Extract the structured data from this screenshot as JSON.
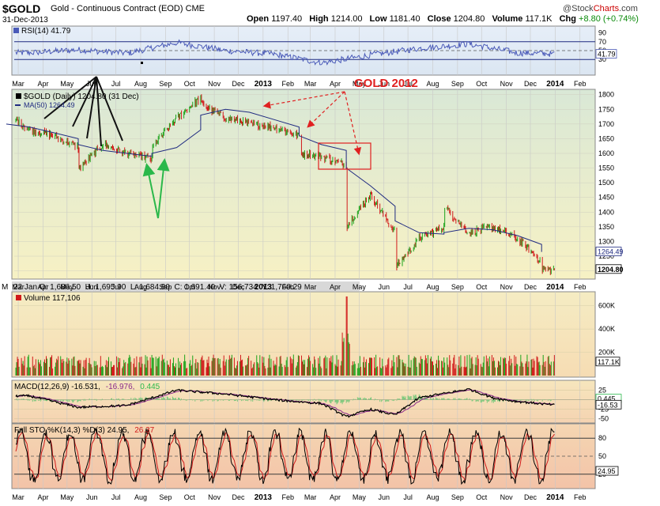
{
  "header": {
    "symbol": "$GOLD",
    "description": "Gold - Continuous Contract (EOD)",
    "exchange": "CME",
    "date": "31-Dec-2013",
    "open_label": "Open",
    "open": "1197.40",
    "high_label": "High",
    "high": "1214.00",
    "low_label": "Low",
    "low": "1181.40",
    "close_label": "Close",
    "close": "1204.80",
    "volume_label": "Volume",
    "volume": "117.1K",
    "chg_label": "Chg",
    "chg": "+8.80 (+0.74%)",
    "brand_at": "@",
    "brand_stock": "Stock",
    "brand_charts": "Charts",
    "brand_com": ".com"
  },
  "colors": {
    "price_bg_top": "#d9e8d6",
    "price_bg_bottom": "#f7f1c4",
    "lower_bg_top": "#f7f1c4",
    "lower_bg_bottom": "#f5c8ad",
    "panel_bg": "#f2f2f2",
    "up": "#1aa31a",
    "down": "#d11a1a",
    "ma": "#1f2a80",
    "rsi": "#4a5ab8",
    "annotation_red": "#e02020",
    "annotation_green": "#2ab84a",
    "annotation_black": "#111111"
  },
  "x_axis_labels": [
    "Mar",
    "Apr",
    "May",
    "Jun",
    "Jul",
    "Aug",
    "Sep",
    "Oct",
    "Nov",
    "Dec",
    "2013",
    "Feb",
    "Mar",
    "Apr",
    "May",
    "Jun",
    "Jul",
    "Aug",
    "Sep",
    "Oct",
    "Nov",
    "Dec",
    "2014",
    "Feb"
  ],
  "x_axis_bold": [
    "2013",
    "2014"
  ],
  "info_bar": {
    "prefix": "M",
    "text": "22 Jan O: 1,686.50  H: 1,695.90  L: 1,684.80  C: 1,691.40  V: 156,734  Y: 1,760.29"
  },
  "annotations": {
    "title": "GOLD 2012"
  },
  "chart_data": [
    {
      "type": "line",
      "panel": "rsi",
      "title": "RSI(14) 41.79",
      "ylim": [
        0,
        100
      ],
      "ticks": [
        30,
        50,
        70,
        90
      ],
      "levels": [
        30,
        70
      ],
      "last_label": "41.79",
      "x": [
        "2012-03",
        "2012-05",
        "2012-07",
        "2012-09",
        "2012-11",
        "2013-01",
        "2013-03",
        "2013-05",
        "2013-07",
        "2013-09",
        "2013-11",
        "2014-01"
      ],
      "values": [
        45,
        52,
        44,
        68,
        50,
        42,
        22,
        40,
        55,
        65,
        45,
        41.79
      ]
    },
    {
      "type": "bar",
      "panel": "price",
      "title": "$GOLD (Daily) 1204.80 (31 Dec)",
      "ma_label": "MA(50) 1264.49",
      "ylim": [
        1180,
        1810
      ],
      "ticks": [
        1200,
        1250,
        1300,
        1350,
        1400,
        1450,
        1500,
        1550,
        1600,
        1650,
        1700,
        1750,
        1800
      ],
      "tick_labels": [
        "1200",
        "1250",
        "1300",
        "1350",
        "1400",
        "1450",
        "1500",
        "1550",
        "1600",
        "1650",
        "1700",
        "1750",
        "1800"
      ],
      "last_label": "1204.80",
      "ma_last_label": "1264.49",
      "x": [
        "2012-02",
        "2012-03",
        "2012-04",
        "2012-05",
        "2012-05",
        "2012-06",
        "2012-07",
        "2012-08",
        "2012-08",
        "2012-09",
        "2012-10",
        "2012-10",
        "2012-11",
        "2012-12",
        "2013-01",
        "2013-02",
        "2013-02",
        "2013-03",
        "2013-04",
        "2013-04",
        "2013-05",
        "2013-06",
        "2013-06",
        "2013-07",
        "2013-08",
        "2013-08",
        "2013-09",
        "2013-10",
        "2013-11",
        "2013-12",
        "2013-12"
      ],
      "values": [
        1740,
        1680,
        1660,
        1620,
        1545,
        1630,
        1600,
        1580,
        1620,
        1720,
        1790,
        1770,
        1720,
        1700,
        1690,
        1660,
        1600,
        1590,
        1560,
        1350,
        1460,
        1330,
        1210,
        1310,
        1350,
        1420,
        1330,
        1350,
        1310,
        1230,
        1204.8
      ],
      "ma_values": [
        1700,
        1690,
        1670,
        1650,
        1630,
        1610,
        1600,
        1590,
        1600,
        1620,
        1680,
        1730,
        1750,
        1740,
        1715,
        1690,
        1660,
        1630,
        1610,
        1550,
        1490,
        1420,
        1370,
        1330,
        1325,
        1330,
        1345,
        1340,
        1320,
        1290,
        1264.49
      ]
    },
    {
      "type": "bar",
      "panel": "volume",
      "title": "Volume 117,106",
      "ylim": [
        0,
        700000
      ],
      "ticks": [
        200000,
        400000,
        600000
      ],
      "tick_labels": [
        "200K",
        "400K",
        "600K"
      ],
      "last_label": "117.1K",
      "spike": {
        "x": "2013-04",
        "value": 680000
      }
    },
    {
      "type": "line",
      "panel": "macd",
      "title": "MACD(12,26,9) -16.531, -16.976, 0.445",
      "title_parts": [
        "MACD(12,26,9) -16.531,",
        "-16.976,",
        "0.445"
      ],
      "ylim": [
        -55,
        45
      ],
      "ticks": [
        -50,
        -25,
        0,
        25
      ],
      "tick_labels": [
        "-50",
        "-25",
        "0",
        "25"
      ],
      "last_labels": [
        "0.445",
        "-16.53"
      ],
      "x": [
        "2012-03",
        "2012-05",
        "2012-07",
        "2012-09",
        "2012-11",
        "2013-01",
        "2013-03",
        "2013-04",
        "2013-05",
        "2013-06",
        "2013-07",
        "2013-09",
        "2013-10",
        "2013-11",
        "2014-01"
      ],
      "values": [
        10,
        -20,
        -15,
        25,
        15,
        0,
        -10,
        -45,
        -25,
        -40,
        5,
        28,
        5,
        -5,
        -16.531
      ]
    },
    {
      "type": "line",
      "panel": "stochastic",
      "title": "Full STO %K(14,3) %D(3) 24.95, 26.37",
      "title_parts": [
        "Full STO %K(14,3) %D(3) 24.95,",
        "26.37"
      ],
      "ylim": [
        0,
        100
      ],
      "ticks": [
        20,
        50,
        80
      ],
      "tick_labels": [
        "20",
        "50",
        "80"
      ],
      "levels": [
        20,
        80
      ],
      "last_label": "24.95"
    }
  ]
}
